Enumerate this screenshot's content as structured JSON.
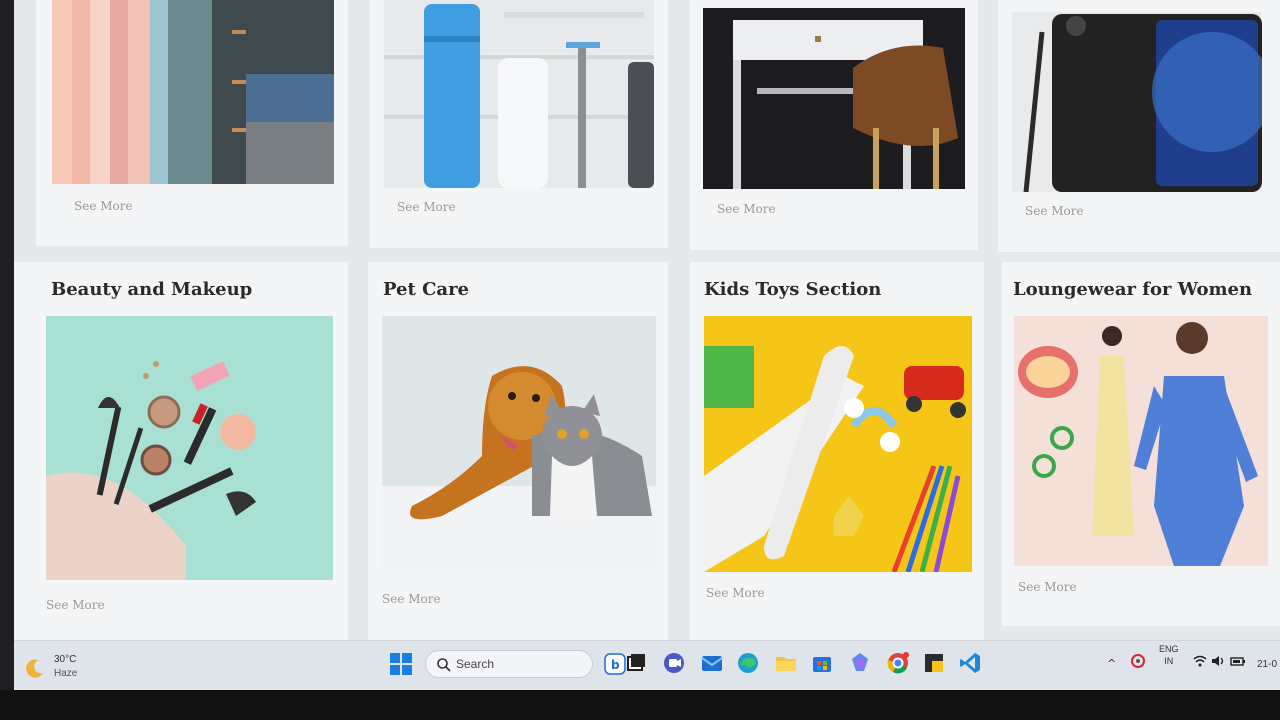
{
  "top_row": {
    "see_more": [
      "See More",
      "See More",
      "See More",
      "See More"
    ]
  },
  "categories": [
    {
      "title": "Beauty and Makeup",
      "see_more": "See More"
    },
    {
      "title": "Pet Care",
      "see_more": "See More"
    },
    {
      "title": "Kids Toys Section",
      "see_more": "See More"
    },
    {
      "title": "Loungewear for Women",
      "see_more": "See More"
    }
  ],
  "taskbar": {
    "weather": {
      "temp": "30°C",
      "desc": "Haze"
    },
    "search_label": "Search",
    "lang_line1": "ENG",
    "lang_line2": "IN",
    "clock": "21-0"
  },
  "icons": {
    "pinned": [
      "bing-icon",
      "task-view-icon",
      "meet-icon",
      "mail-icon",
      "edge-icon",
      "file-explorer-icon",
      "store-icon",
      "copilot-icon",
      "chrome-icon",
      "sticky-notes-icon",
      "vscode-icon"
    ]
  },
  "colors": {
    "accent_blue": "#0a6fd6",
    "toys_yellow": "#f5c518",
    "beauty_mint": "#a9e0d4"
  }
}
